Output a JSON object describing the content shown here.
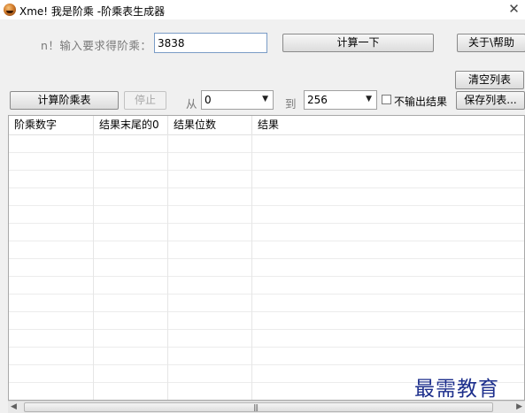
{
  "window": {
    "title": "Xme! 我是阶乘  -阶乘表生成器",
    "close_glyph": "✕"
  },
  "form": {
    "n_label": "n！输入要求得阶乘：",
    "n_value": "3838",
    "calc_button": "计算一下",
    "about_button": "关于\\帮助",
    "clear_button": "清空列表",
    "calc_table_button": "计算阶乘表",
    "stop_button": "停止",
    "from_label": "从",
    "from_value": "0",
    "to_label": "到",
    "to_value": "256",
    "no_output_label": "不输出结果",
    "no_output_checked": false,
    "save_button": "保存列表..."
  },
  "list": {
    "columns": [
      "阶乘数字",
      "结果末尾的0",
      "结果位数",
      "结果"
    ],
    "rows": []
  },
  "scrollbar": {
    "left_arrow": "◀",
    "right_arrow": "▶",
    "grip": "|||"
  },
  "watermark": {
    "text": "最需教育"
  },
  "colors": {
    "window_bg": "#f0f0f0",
    "watermark": "#1d2f8c",
    "input_border": "#7a9cc6"
  },
  "icons": {
    "app": "xme-face-icon",
    "close": "close-icon",
    "dropdown": "chevron-down-icon"
  }
}
